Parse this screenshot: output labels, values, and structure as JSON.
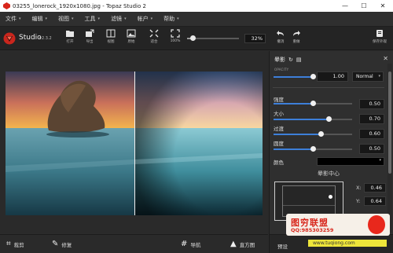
{
  "window": {
    "title": "03255_lonerock_1920x1080.jpg - Topaz Studio 2",
    "minimize": "—",
    "maximize": "☐",
    "close": "✕"
  },
  "menu": [
    {
      "label": "文件"
    },
    {
      "label": "编辑"
    },
    {
      "label": "视图"
    },
    {
      "label": "工具"
    },
    {
      "label": "滤镜"
    },
    {
      "label": "帐户"
    },
    {
      "label": "帮助"
    }
  ],
  "studio": {
    "name": "Studio",
    "version": "v2.3.2"
  },
  "toolbar": {
    "buttons": [
      {
        "label": "打开",
        "icon": "folder-icon"
      },
      {
        "label": "导出",
        "icon": "export-icon"
      },
      {
        "label": "视图",
        "icon": "view-icon"
      },
      {
        "label": "原始",
        "icon": "original-icon"
      },
      {
        "label": "适合",
        "icon": "fit-icon"
      },
      {
        "label": "100%",
        "icon": "fullsize-icon"
      }
    ],
    "zoom_value": "32%",
    "zoom_level": 0.1,
    "undo_label": "撤消",
    "redo_label": "重做",
    "save_label": "保存外观"
  },
  "panel": {
    "title": "晕影",
    "opacity_label": "OPACITY",
    "opacity_value": "1.00",
    "blend_mode": "Normal",
    "params": [
      {
        "label": "强度",
        "value": "0.50",
        "level": 0.5
      },
      {
        "label": "大小",
        "value": "0.70",
        "level": 0.7
      },
      {
        "label": "过渡",
        "value": "0.60",
        "level": 0.6
      },
      {
        "label": "圆度",
        "value": "0.50",
        "level": 0.5
      }
    ],
    "color_label": "颜色",
    "color_value": "#000000",
    "center_title": "晕影中心",
    "center_x_label": "X:",
    "center_x": "0.46",
    "center_y_label": "Y:",
    "center_y": "0.64"
  },
  "bottom": {
    "crop_label": "裁剪",
    "repair_label": "修复",
    "navigator_label": "导航",
    "histogram_label": "直方图",
    "presets_label": "预设"
  },
  "watermark": {
    "title": "图穷联盟",
    "qq": "QQ:985303259",
    "url": "www.tuqiong.com"
  },
  "colors": {
    "accent": "#3d7fd9",
    "brand_red": "#d8261b"
  }
}
